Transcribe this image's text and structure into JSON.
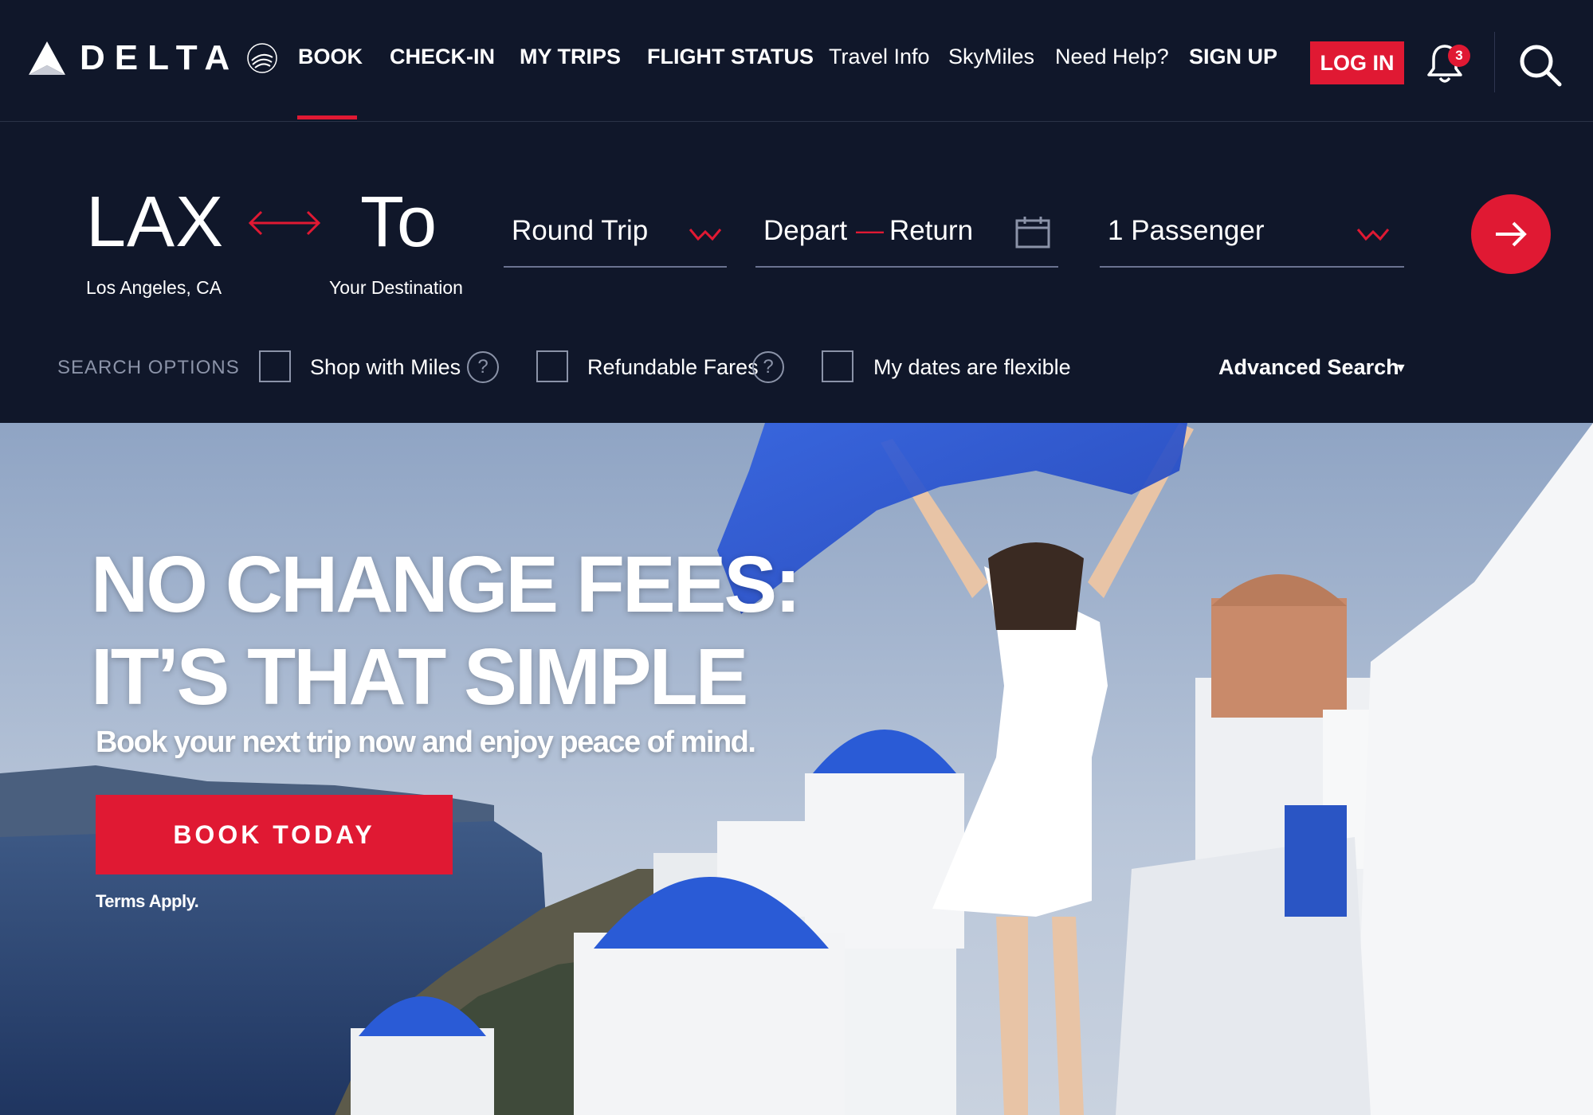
{
  "brand": {
    "name": "DELTA",
    "skyteam_mark": "SKYTEAM"
  },
  "nav": {
    "items": [
      {
        "label": "BOOK"
      },
      {
        "label": "CHECK-IN"
      },
      {
        "label": "MY TRIPS"
      },
      {
        "label": "FLIGHT STATUS"
      },
      {
        "label": "Travel Info"
      },
      {
        "label": "SkyMiles"
      },
      {
        "label": "Need Help?"
      }
    ],
    "active": "BOOK",
    "sign_up": "SIGN UP",
    "log_in": "LOG IN",
    "notification_count": "3"
  },
  "booking": {
    "origin_code": "LAX",
    "origin_city": "Los Angeles, CA",
    "destination_code": "To",
    "destination_city": "Your Destination",
    "trip_type": "Round Trip",
    "depart": "Depart",
    "date_separator": "—",
    "return": "Return",
    "passengers": "1 Passenger",
    "search_options_label": "SEARCH OPTIONS",
    "options": [
      {
        "label": "Shop with Miles",
        "checked": false,
        "help": "?"
      },
      {
        "label": "Refundable Fares",
        "checked": false,
        "help": "?"
      },
      {
        "label": "My dates are flexible",
        "checked": false
      }
    ],
    "advanced_search": "Advanced Search",
    "advanced_caret": "▼"
  },
  "hero": {
    "title_line1": "NO CHANGE FEES:",
    "title_line2": "IT’S THAT SIMPLE",
    "subtitle": "Book your next trip now and enjoy peace of mind.",
    "cta": "BOOK TODAY",
    "terms": "Terms Apply."
  },
  "colors": {
    "navy": "#10172a",
    "accent_red": "#e01933",
    "muted_gray": "#8b93a8"
  },
  "icons": {
    "logo": "delta-widget-icon",
    "skyteam": "skyteam-icon",
    "swap": "swap-arrows-icon",
    "trip_caret": "chevron-down-icon",
    "calendar": "calendar-icon",
    "submit": "arrow-right-icon",
    "bell": "bell-icon",
    "search": "search-icon",
    "help": "question-icon"
  }
}
